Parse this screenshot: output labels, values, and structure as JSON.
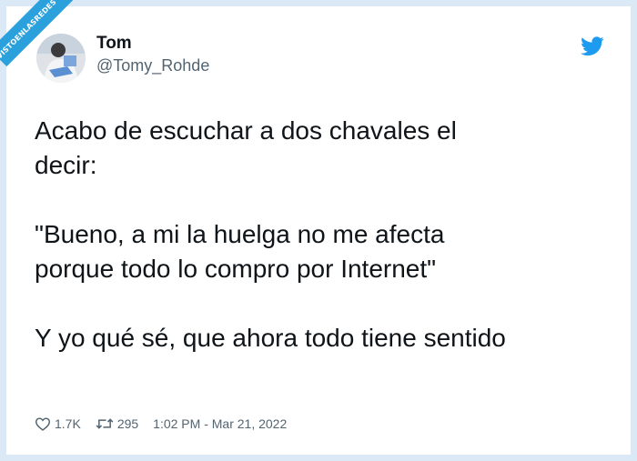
{
  "watermark": {
    "text": "VISTOENLASREDES .com"
  },
  "author": {
    "display_name": "Tom",
    "handle": "@Tomy_Rohde"
  },
  "tweet": {
    "text": "Acabo de escuchar a dos chavales el\ndecir:\n\n\"Bueno, a mi la huelga no me afecta\nporque todo lo compro por Internet\"\n\nY yo qué sé, que ahora todo tiene sentido"
  },
  "stats": {
    "likes": "1.7K",
    "retweets": "295",
    "timestamp": "1:02 PM - Mar 21, 2022"
  },
  "colors": {
    "brand": "#1d9bf0",
    "text": "#0f1419",
    "muted": "#536471",
    "frame": "#dbe9f6"
  },
  "icons": {
    "like": "heart-icon",
    "retweet": "retweet-icon",
    "logo": "twitter-bird-icon"
  }
}
